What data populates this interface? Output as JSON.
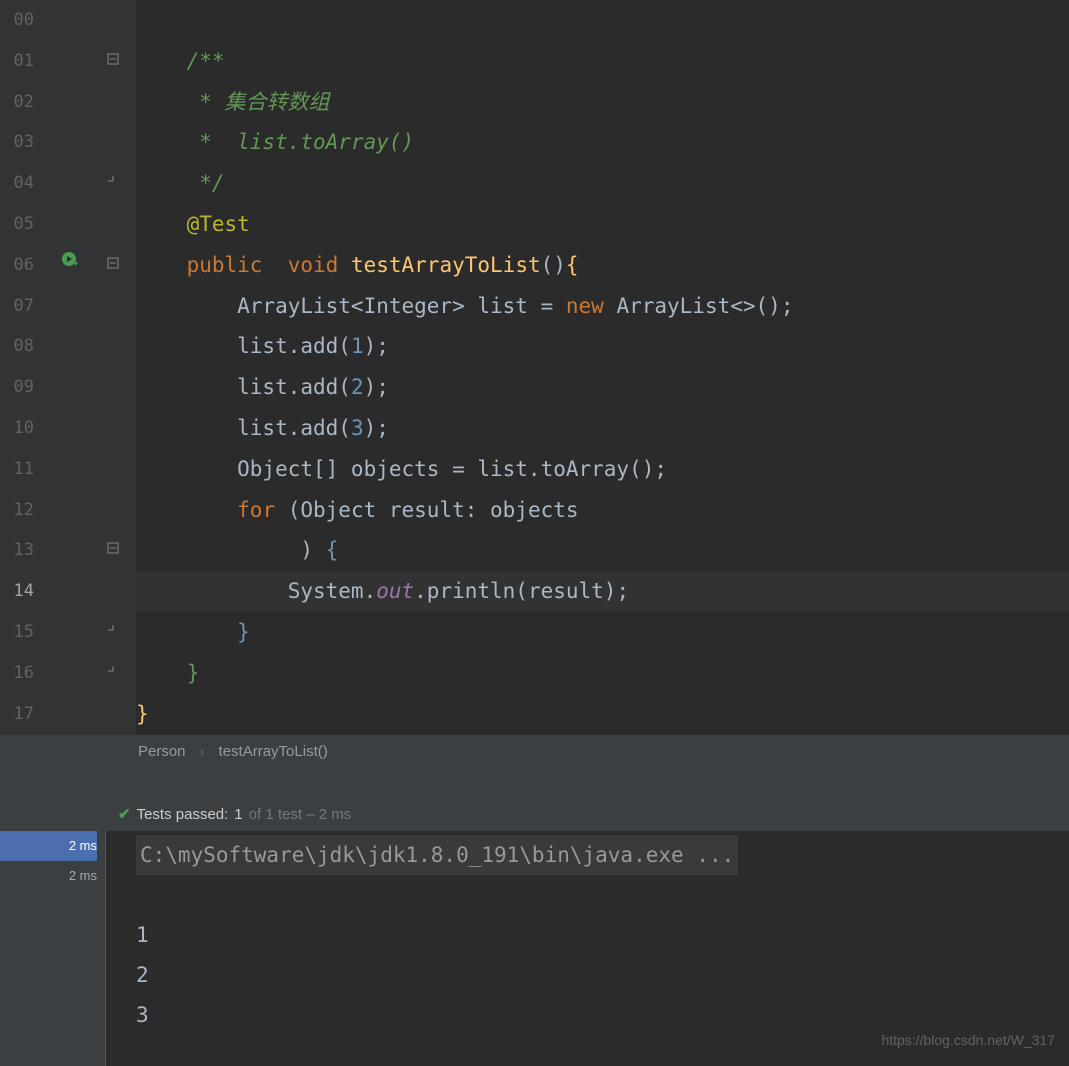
{
  "gutter": {
    "start": 0,
    "end": 17,
    "current": 14
  },
  "code": {
    "lines": [
      {
        "n": "00",
        "segs": []
      },
      {
        "n": "01",
        "segs": [
          {
            "t": "    ",
            "c": ""
          },
          {
            "t": "/**",
            "c": "c-comment-green"
          }
        ]
      },
      {
        "n": "02",
        "segs": [
          {
            "t": "    ",
            "c": ""
          },
          {
            "t": " * 集合转数组",
            "c": "c-comment-green"
          }
        ]
      },
      {
        "n": "03",
        "segs": [
          {
            "t": "    ",
            "c": ""
          },
          {
            "t": " *  list.toArray()",
            "c": "c-comment-green"
          }
        ]
      },
      {
        "n": "04",
        "segs": [
          {
            "t": "    ",
            "c": ""
          },
          {
            "t": " */",
            "c": "c-comment-green"
          }
        ]
      },
      {
        "n": "05",
        "segs": [
          {
            "t": "    ",
            "c": ""
          },
          {
            "t": "@Test",
            "c": "c-annotation"
          }
        ]
      },
      {
        "n": "06",
        "segs": [
          {
            "t": "    ",
            "c": ""
          },
          {
            "t": "public  ",
            "c": "c-keyword"
          },
          {
            "t": "void ",
            "c": "c-keyword"
          },
          {
            "t": "testArrayToList",
            "c": "c-method"
          },
          {
            "t": "()",
            "c": "c-text"
          },
          {
            "t": "{",
            "c": "c-brace-y"
          }
        ]
      },
      {
        "n": "07",
        "segs": [
          {
            "t": "        ArrayList<Integer> list = ",
            "c": "c-text"
          },
          {
            "t": "new ",
            "c": "c-keyword"
          },
          {
            "t": "ArrayList<>();",
            "c": "c-text"
          }
        ]
      },
      {
        "n": "08",
        "segs": [
          {
            "t": "        list.add(",
            "c": "c-text"
          },
          {
            "t": "1",
            "c": "c-number"
          },
          {
            "t": ");",
            "c": "c-text"
          }
        ]
      },
      {
        "n": "09",
        "segs": [
          {
            "t": "        list.add(",
            "c": "c-text"
          },
          {
            "t": "2",
            "c": "c-number"
          },
          {
            "t": ");",
            "c": "c-text"
          }
        ]
      },
      {
        "n": "10",
        "segs": [
          {
            "t": "        list.add(",
            "c": "c-text"
          },
          {
            "t": "3",
            "c": "c-number"
          },
          {
            "t": ");",
            "c": "c-text"
          }
        ]
      },
      {
        "n": "11",
        "segs": [
          {
            "t": "        Object[] objects = list.toArray();",
            "c": "c-text"
          }
        ]
      },
      {
        "n": "12",
        "segs": [
          {
            "t": "        ",
            "c": ""
          },
          {
            "t": "for ",
            "c": "c-keyword"
          },
          {
            "t": "(Object result: objects",
            "c": "c-text"
          }
        ]
      },
      {
        "n": "13",
        "segs": [
          {
            "t": "             ) ",
            "c": "c-text"
          },
          {
            "t": "{",
            "c": "c-brace-b"
          }
        ]
      },
      {
        "n": "14",
        "hl": true,
        "segs": [
          {
            "t": "            System.",
            "c": "c-text"
          },
          {
            "t": "out",
            "c": "c-field"
          },
          {
            "t": ".println(result);",
            "c": "c-text"
          }
        ]
      },
      {
        "n": "15",
        "segs": [
          {
            "t": "        ",
            "c": ""
          },
          {
            "t": "}",
            "c": "c-brace-b"
          }
        ]
      },
      {
        "n": "16",
        "segs": [
          {
            "t": "    ",
            "c": ""
          },
          {
            "t": "}",
            "c": "c-brace-g"
          }
        ]
      },
      {
        "n": "17",
        "segs": [
          {
            "t": "",
            "c": ""
          },
          {
            "t": "}",
            "c": "c-brace-y"
          }
        ]
      }
    ]
  },
  "breadcrumb": {
    "items": [
      "Person",
      "testArrayToList()"
    ]
  },
  "test": {
    "label": "Tests passed:",
    "passed": "1",
    "suffix": "of 1 test – 2 ms"
  },
  "timings": [
    "2 ms",
    "2 ms"
  ],
  "console": {
    "command": "C:\\mySoftware\\jdk\\jdk1.8.0_191\\bin\\java.exe ...",
    "output": [
      "1",
      "2",
      "3"
    ]
  },
  "watermark": "https://blog.csdn.net/W_317",
  "icons": {
    "run": "⟳",
    "check": "✔",
    "sep": "›"
  },
  "folds": [
    {
      "row": 1,
      "type": "top"
    },
    {
      "row": 4,
      "type": "bot"
    },
    {
      "row": 6,
      "type": "top"
    },
    {
      "row": 13,
      "type": "top"
    },
    {
      "row": 15,
      "type": "bot"
    },
    {
      "row": 16,
      "type": "bot"
    }
  ]
}
